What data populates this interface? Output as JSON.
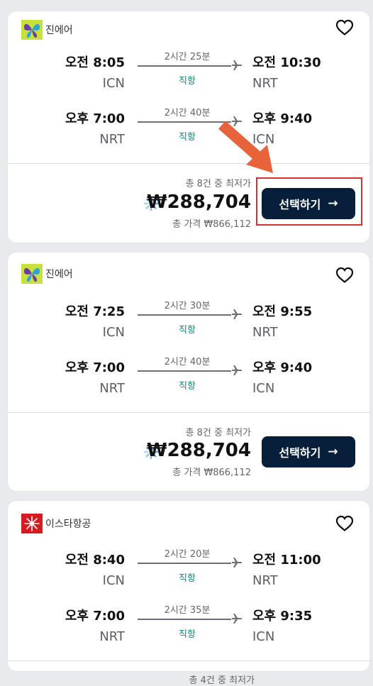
{
  "colors": {
    "button_bg": "#071f3a",
    "direct_color": "#0a8a7b",
    "highlight": "#d63031",
    "pointer_arrow": "#e8623a"
  },
  "cards": [
    {
      "airline": "진에어",
      "logo_icon": "butterfly-logo-icon",
      "legs": [
        {
          "dep_time": "오전 8:05",
          "dep_code": "ICN",
          "duration": "2시간 25분",
          "stops": "직항",
          "arr_time": "오전 10:30",
          "arr_code": "NRT"
        },
        {
          "dep_time": "오후 7:00",
          "dep_code": "NRT",
          "duration": "2시간 40분",
          "stops": "직항",
          "arr_time": "오후 9:40",
          "arr_code": "ICN"
        }
      ],
      "price_count": "총 8건 중 최저가",
      "price": "₩288,704",
      "total_price": "총 가격 ₩866,112",
      "select_label": "선택하기",
      "select_arrow": "→"
    },
    {
      "airline": "진에어",
      "logo_icon": "butterfly-logo-icon",
      "legs": [
        {
          "dep_time": "오전 7:25",
          "dep_code": "ICN",
          "duration": "2시간 30분",
          "stops": "직항",
          "arr_time": "오전 9:55",
          "arr_code": "NRT"
        },
        {
          "dep_time": "오후 7:00",
          "dep_code": "NRT",
          "duration": "2시간 40분",
          "stops": "직항",
          "arr_time": "오후 9:40",
          "arr_code": "ICN"
        }
      ],
      "price_count": "총 8건 중 최저가",
      "price": "₩288,704",
      "total_price": "총 가격 ₩866,112",
      "select_label": "선택하기",
      "select_arrow": "→"
    },
    {
      "airline": "이스타항공",
      "logo_icon": "star-logo-icon",
      "legs": [
        {
          "dep_time": "오전 8:40",
          "dep_code": "ICN",
          "duration": "2시간 20분",
          "stops": "직항",
          "arr_time": "오전 11:00",
          "arr_code": "NRT"
        },
        {
          "dep_time": "오후 7:00",
          "dep_code": "NRT",
          "duration": "2시간 35분",
          "stops": "직항",
          "arr_time": "오후 9:35",
          "arr_code": "ICN"
        }
      ],
      "price_count": "총 4건 중 최저가"
    }
  ]
}
